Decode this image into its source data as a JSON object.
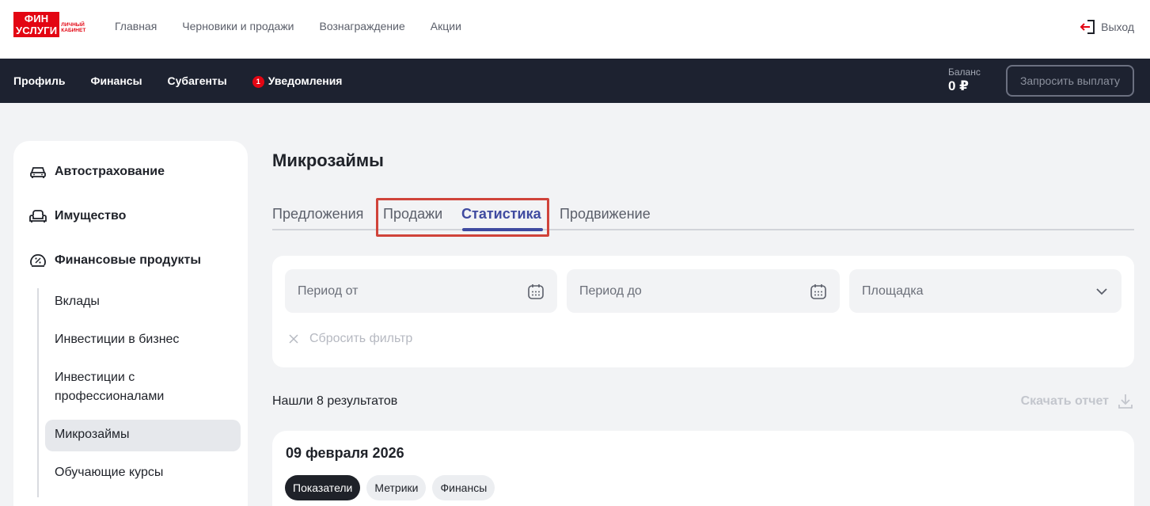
{
  "header": {
    "logo_line1": "ФИН",
    "logo_line2": "УСЛУГИ",
    "logo_sub1": "Личный",
    "logo_sub2": "кабинет",
    "nav": [
      "Главная",
      "Черновики и продажи",
      "Вознаграждение",
      "Акции"
    ],
    "logout_label": "Выход"
  },
  "subnav": {
    "items": [
      "Профиль",
      "Финансы",
      "Субагенты",
      "Уведомления"
    ],
    "notifications_count": "1",
    "balance_label": "Баланс",
    "balance_value": "0 ₽",
    "payout_button": "Запросить выплату"
  },
  "sidebar": {
    "categories": [
      "Автострахование",
      "Имущество",
      "Финансовые продукты"
    ],
    "subitems": [
      "Вклады",
      "Инвестиции в бизнес",
      "Инвестиции с",
      "профессионалами",
      "Микрозаймы",
      "Обучающие курсы"
    ],
    "active_subitem": "Микрозаймы"
  },
  "main": {
    "title": "Микрозаймы",
    "tabs": [
      "Предложения",
      "Продажи",
      "Статистика",
      "Продвижение"
    ],
    "active_tab": "Статистика",
    "filters": {
      "period_from": "Период от",
      "period_to": "Период до",
      "platform": "Площадка",
      "reset": "Сбросить фильтр"
    },
    "results_text": "Нашли 8 результатов",
    "download_label": "Скачать отчет",
    "day_card": {
      "date": "09 февраля 2026",
      "chips": [
        "Показатели",
        "Метрики",
        "Финансы"
      ],
      "active_chip": "Показатели"
    }
  },
  "colors": {
    "brand_red": "#e30613",
    "dark_nav": "#1d2230",
    "accent": "#3f4aa0",
    "highlight": "#d0433a"
  }
}
